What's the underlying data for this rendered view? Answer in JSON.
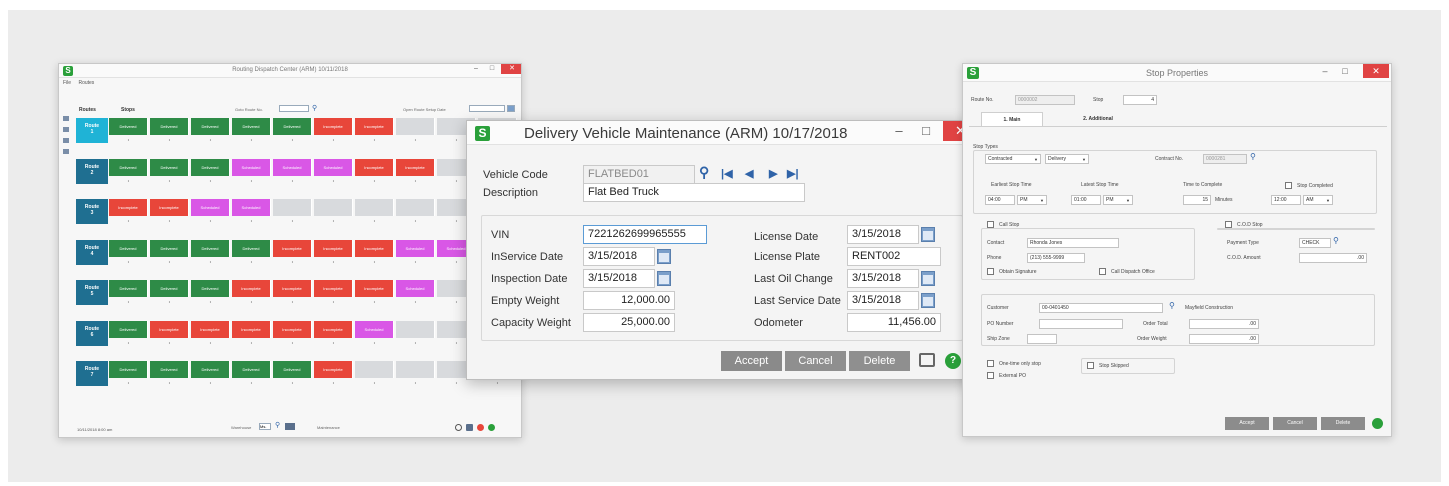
{
  "rdc": {
    "title": "Routing Dispatch Center (ARM) 10/11/2018",
    "menu": [
      "File",
      "Routes"
    ],
    "headers": {
      "routes": "Routes",
      "stops": "Stops",
      "goto_route": "Goto Route No.",
      "open_route_setup": "Open Route Setup Date"
    },
    "routes": [
      {
        "line1": "Route",
        "line2": "1",
        "color": "#1fb3d6",
        "stops": [
          "Delivered",
          "Delivered",
          "Delivered",
          "Delivered",
          "Delivered",
          "Incomplete",
          "Incomplete",
          "",
          "",
          ""
        ]
      },
      {
        "line1": "Route",
        "line2": "2",
        "color": "#1f6f91",
        "stops": [
          "Delivered",
          "Delivered",
          "Delivered",
          "Scheduled",
          "Scheduled",
          "Scheduled",
          "Incomplete",
          "Incomplete",
          "",
          ""
        ]
      },
      {
        "line1": "Route",
        "line2": "3",
        "color": "#1f6f91",
        "stops": [
          "Incomplete",
          "Incomplete",
          "Scheduled",
          "Scheduled",
          "",
          "",
          "",
          "",
          "",
          ""
        ]
      },
      {
        "line1": "Route",
        "line2": "4",
        "color": "#1f6f91",
        "stops": [
          "Delivered",
          "Delivered",
          "Delivered",
          "Delivered",
          "Incomplete",
          "Incomplete",
          "Incomplete",
          "Scheduled",
          "Scheduled",
          "Scheduled"
        ]
      },
      {
        "line1": "Route",
        "line2": "5",
        "color": "#1f6f91",
        "stops": [
          "Delivered",
          "Delivered",
          "Delivered",
          "Incomplete",
          "Incomplete",
          "Incomplete",
          "Incomplete",
          "Scheduled",
          "",
          ""
        ]
      },
      {
        "line1": "Route",
        "line2": "6",
        "color": "#1f6f91",
        "stops": [
          "Delivered",
          "Incomplete",
          "Incomplete",
          "Incomplete",
          "Incomplete",
          "Incomplete",
          "Scheduled",
          "",
          "",
          ""
        ]
      },
      {
        "line1": "Route",
        "line2": "7",
        "color": "#1f6f91",
        "stops": [
          "Delivered",
          "Delivered",
          "Delivered",
          "Delivered",
          "Delivered",
          "Incomplete",
          "",
          "",
          "",
          ""
        ]
      }
    ],
    "status_time": "10/11/2018 8:00 am",
    "footer_label": "Warehouse",
    "footer_value": "Ms.",
    "footer_right": "Maintenance"
  },
  "dvm": {
    "title": "Delivery Vehicle Maintenance (ARM) 10/17/2018",
    "labels": {
      "vehicle_code": "Vehicle Code",
      "description": "Description",
      "vin": "VIN",
      "inservice_date": "InService Date",
      "inspection_date": "Inspection Date",
      "empty_weight": "Empty Weight",
      "capacity_weight": "Capacity Weight",
      "license_date": "License Date",
      "license_plate": "License Plate",
      "last_oil_change": "Last Oil Change",
      "last_service_date": "Last Service Date",
      "odometer": "Odometer"
    },
    "values": {
      "vehicle_code": "FLATBED01",
      "description": "Flat Bed Truck",
      "vin": "7221262699965555",
      "inservice_date": "3/15/2018",
      "inspection_date": "3/15/2018",
      "empty_weight": "12,000.00",
      "capacity_weight": "25,000.00",
      "license_date": "3/15/2018",
      "license_plate": "RENT002",
      "last_oil_change": "3/15/2018",
      "last_service_date": "3/15/2018",
      "odometer": "11,456.00"
    },
    "buttons": {
      "accept": "Accept",
      "cancel": "Cancel",
      "delete": "Delete"
    }
  },
  "stp": {
    "title": "Stop Properties",
    "route_no_label": "Route No.",
    "route_no": "0000002",
    "stop_label": "Stop",
    "stop_value": "4",
    "tabs": [
      "1. Main",
      "2. Additional"
    ],
    "stop_types_label": "Stop Types",
    "stop_type": "Contracted",
    "stop_mode": "Delivery",
    "contract_no_label": "Contract No.",
    "contract_no": "0000281",
    "earliest_label": "Earliest Stop Time",
    "earliest_time": "04:00",
    "earliest_ampm": "PM",
    "latest_label": "Latest Stop Time",
    "latest_time": "01:00",
    "latest_ampm": "PM",
    "complete_label": "Time to Complete",
    "complete_value": "15",
    "minutes_label": "Minutes",
    "stop_completed_label": "Stop Completed",
    "completed_time": "12:00",
    "completed_ampm": "AM",
    "call_stop_label": "Call Stop",
    "contact_label": "Contact",
    "contact": "Rhonda Jones",
    "phone_label": "Phone",
    "phone": "(213) 555-9999",
    "obtain_signature_label": "Obtain Signature",
    "call_dispatch_label": "Call Dispatch Office",
    "cod_stop_label": "C.O.D Stop",
    "payment_type_label": "Payment Type",
    "payment_type": "CHECK",
    "cod_amount_label": "C.O.D. Amount",
    "cod_amount": ".00",
    "customer_label": "Customer",
    "customer_no": "00-0401450",
    "customer_name": "Mayfield Construction",
    "po_number_label": "PO Number",
    "order_total_label": "Order Total",
    "order_total": ".00",
    "ship_zone_label": "Ship Zone",
    "order_weight_label": "Order Weight",
    "order_weight": ".00",
    "onetime_label": "One-time only stop",
    "external_po_label": "External PO",
    "stop_skipped_label": "Stop Skipped",
    "buttons": {
      "accept": "Accept",
      "cancel": "Cancel",
      "delete": "Delete"
    }
  },
  "colors": {
    "delivered": "#2e8b47",
    "incomplete": "#e8463a",
    "scheduled": "#d957e6",
    "empty": "#d8dadd",
    "brand_green": "#2aa03a",
    "close_red": "#e04343"
  }
}
